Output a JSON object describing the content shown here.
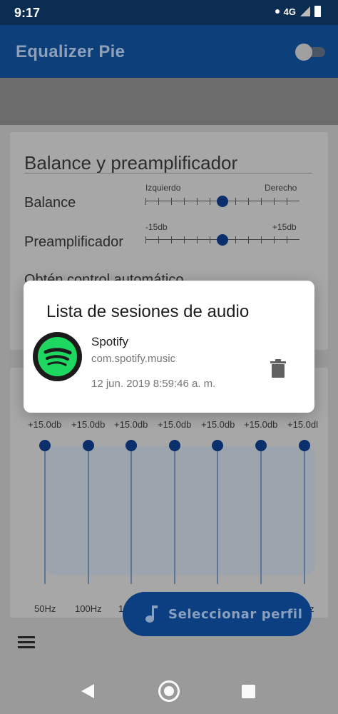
{
  "status": {
    "time": "9:17",
    "network_label": "4G"
  },
  "app": {
    "title": "Equalizer Pie"
  },
  "balance_card": {
    "heading": "Balance y preamplificador",
    "balance": {
      "label": "Balance",
      "left": "Izquierdo",
      "right": "Derecho"
    },
    "preamp": {
      "label": "Preamplificador",
      "left": "-15db",
      "right": "+15db"
    },
    "cut_text": "Obtén control automático"
  },
  "equalizer": {
    "gains": [
      "+15.0db",
      "+15.0db",
      "+15.0db",
      "+15.0db",
      "+15.0db",
      "+15.0db",
      "+15.0dl"
    ],
    "freqs": [
      "50Hz",
      "100Hz",
      "1",
      "z"
    ]
  },
  "fab": {
    "label": "Seleccionar perfil",
    "icon": "music-note-icon"
  },
  "dialog": {
    "title": "Lista de sesiones de audio",
    "session": {
      "name": "Spotify",
      "package": "com.spotify.music",
      "date": "12 jun. 2019 8:59:46 a. m.",
      "icon": "spotify-logo",
      "delete_icon": "trash-icon"
    }
  },
  "colors": {
    "primary": "#0d3f7a",
    "accent": "#0a2f6b",
    "spotify": "#1ed760"
  }
}
